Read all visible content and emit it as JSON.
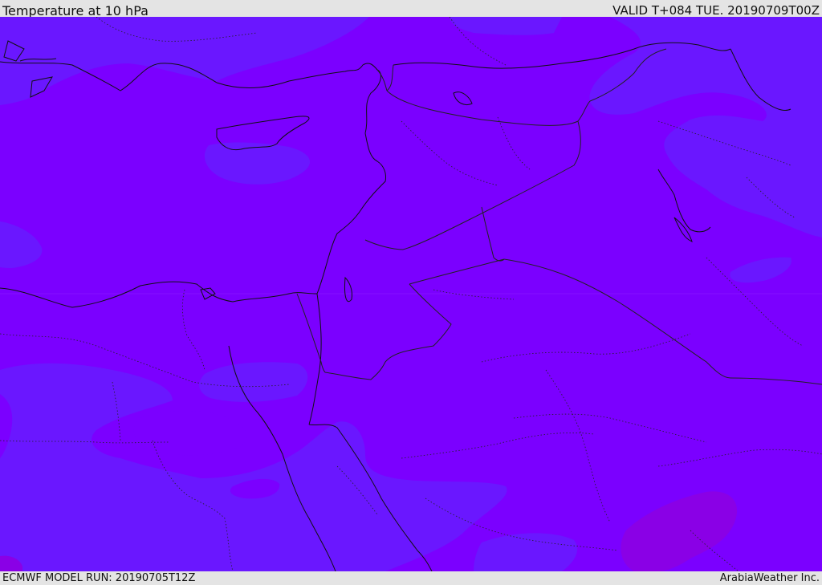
{
  "header": {
    "title": "Temperature at 10 hPa",
    "valid": "VALID T+084 TUE. 20190709T00Z"
  },
  "footer": {
    "model_run": "ECMWF MODEL RUN: 20190705T12Z",
    "credit": "ArabiaWeather Inc."
  },
  "colors": {
    "base_fill": "#7b00ff",
    "cooler_fill": "#6a17ff",
    "warmer_fill": "#8a00e6",
    "coastline": "#111111",
    "border": "#222222",
    "frame": "#e4e4e4"
  }
}
